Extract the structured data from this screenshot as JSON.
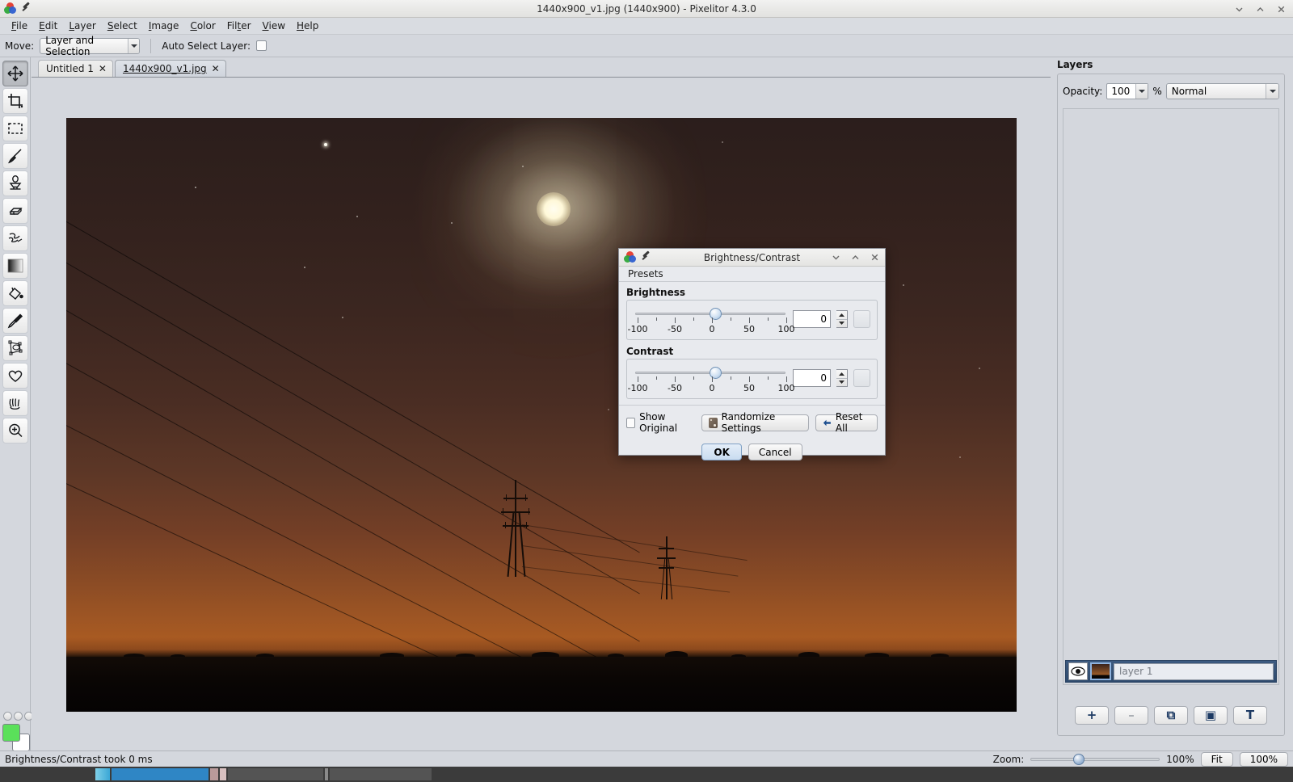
{
  "window": {
    "title": "1440x900_v1.jpg (1440x900) - Pixelitor 4.3.0",
    "minimize_icon": "chevron-down-icon",
    "maximize_icon": "chevron-up-icon",
    "close_icon": "close-icon"
  },
  "menubar": {
    "items": [
      {
        "label": "File",
        "mnemonic": "F"
      },
      {
        "label": "Edit",
        "mnemonic": "E"
      },
      {
        "label": "Layer",
        "mnemonic": "L"
      },
      {
        "label": "Select",
        "mnemonic": "S"
      },
      {
        "label": "Image",
        "mnemonic": "I"
      },
      {
        "label": "Color",
        "mnemonic": "C"
      },
      {
        "label": "Filter",
        "mnemonic": "t"
      },
      {
        "label": "View",
        "mnemonic": "V"
      },
      {
        "label": "Help",
        "mnemonic": "H"
      }
    ]
  },
  "options_bar": {
    "move_label": "Move:",
    "move_value": "Layer and Selection",
    "auto_select_label": "Auto Select Layer:",
    "auto_select_checked": false
  },
  "toolbox": {
    "tools": [
      {
        "name": "move-tool",
        "icon": "move-arrows-icon",
        "selected": true
      },
      {
        "name": "crop-tool",
        "icon": "crop-icon",
        "selected": false
      },
      {
        "name": "selection-tool",
        "icon": "marquee-icon",
        "selected": false
      },
      {
        "name": "brush-tool",
        "icon": "paintbrush-icon",
        "selected": false
      },
      {
        "name": "clone-stamp-tool",
        "icon": "stamp-icon",
        "selected": false
      },
      {
        "name": "eraser-tool",
        "icon": "eraser-icon",
        "selected": false
      },
      {
        "name": "smudge-tool",
        "icon": "smudge-icon",
        "selected": false
      },
      {
        "name": "gradient-tool",
        "icon": "gradient-icon",
        "selected": false
      },
      {
        "name": "paint-bucket-tool",
        "icon": "paint-bucket-icon",
        "selected": false
      },
      {
        "name": "color-picker-tool",
        "icon": "eyedropper-icon",
        "selected": false
      },
      {
        "name": "shapes-tool",
        "icon": "shapes-nodes-icon",
        "selected": false
      },
      {
        "name": "path-tool",
        "icon": "heart-path-icon",
        "selected": false
      },
      {
        "name": "hand-tool",
        "icon": "hand-icon",
        "selected": false
      },
      {
        "name": "zoom-tool",
        "icon": "magnifier-plus-icon",
        "selected": false
      }
    ],
    "foreground_color": "#5ae05a",
    "background_color": "#ffffff"
  },
  "tabs": [
    {
      "label": "Untitled 1",
      "active": false,
      "close_icon": "close-icon"
    },
    {
      "label": "1440x900_v1.jpg",
      "active": true,
      "close_icon": "close-icon"
    }
  ],
  "layers_panel": {
    "title": "Layers",
    "opacity_label": "Opacity:",
    "opacity_value": "100",
    "percent_label": "%",
    "blend_mode": "Normal",
    "layers": [
      {
        "name": "layer 1",
        "visible": true,
        "selected": true,
        "eye_icon": "eye-icon"
      }
    ],
    "buttons": [
      {
        "name": "add-layer-button",
        "glyph": "+",
        "enabled": true
      },
      {
        "name": "delete-layer-button",
        "glyph": "–",
        "enabled": false
      },
      {
        "name": "duplicate-layer-button",
        "glyph": "⧉",
        "enabled": true
      },
      {
        "name": "add-mask-button",
        "glyph": "▣",
        "enabled": true
      },
      {
        "name": "add-text-layer-button",
        "glyph": "T",
        "enabled": true
      }
    ]
  },
  "statusbar": {
    "message": "Brightness/Contrast took 0 ms",
    "zoom_label": "Zoom:",
    "zoom_value": "100%",
    "fit_button": "Fit",
    "actual_size_button": "100%"
  },
  "dialog": {
    "title": "Brightness/Contrast",
    "menu": {
      "presets": "Presets"
    },
    "minimize_icon": "chevron-down-icon",
    "maximize_icon": "chevron-up-icon",
    "close_icon": "close-icon",
    "groups": [
      {
        "name": "brightness",
        "label": "Brightness",
        "value": "0",
        "min": -100,
        "max": 100,
        "tick_labels": [
          "-100",
          "-50",
          "0",
          "50",
          "100"
        ]
      },
      {
        "name": "contrast",
        "label": "Contrast",
        "value": "0",
        "min": -100,
        "max": 100,
        "tick_labels": [
          "-100",
          "-50",
          "0",
          "50",
          "100"
        ]
      }
    ],
    "show_original_label": "Show Original",
    "show_original_checked": false,
    "randomize_label": "Randomize Settings",
    "reset_all_label": "Reset All",
    "ok_label": "OK",
    "cancel_label": "Cancel"
  },
  "canvas": {
    "image_description": "night landscape with moon, power pylons and orange horizon glow"
  }
}
